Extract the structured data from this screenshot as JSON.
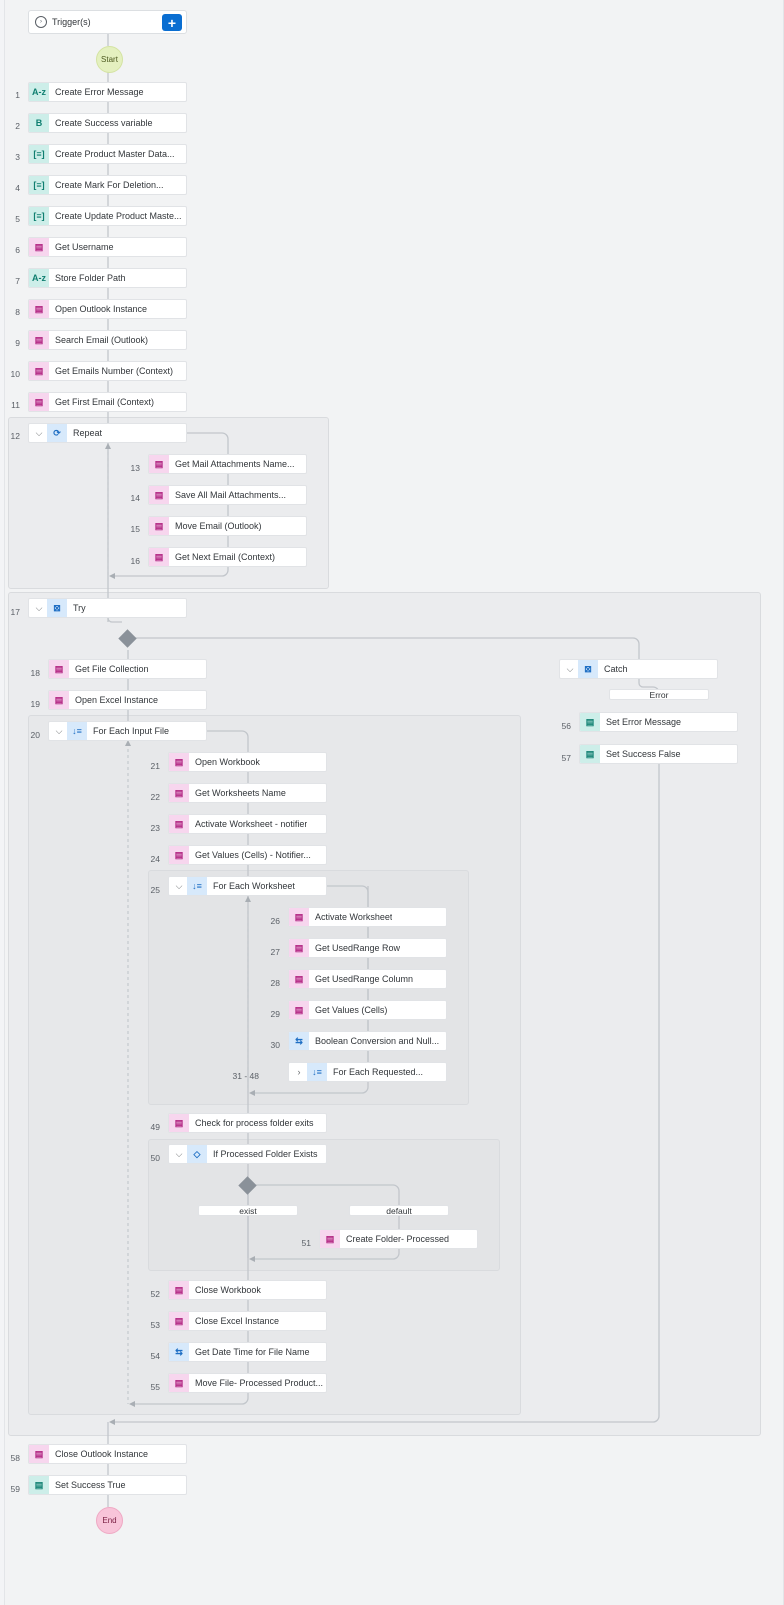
{
  "trigger": {
    "label": "Trigger(s)",
    "add_label": "+"
  },
  "start_label": "Start",
  "end_label": "End",
  "steps": [
    {
      "num": "1",
      "label": "Create Error Message",
      "icon": "A-z",
      "color": "teal",
      "icon_name": "text-variable-icon"
    },
    {
      "num": "2",
      "label": "Create Success variable",
      "icon": "B",
      "color": "teal",
      "icon_name": "boolean-variable-icon"
    },
    {
      "num": "3",
      "label": "Create Product Master Data...",
      "icon": "[≡]",
      "color": "teal",
      "icon_name": "list-variable-icon"
    },
    {
      "num": "4",
      "label": "Create Mark For Deletion...",
      "icon": "[≡]",
      "color": "teal",
      "icon_name": "list-variable-icon"
    },
    {
      "num": "5",
      "label": "Create Update Product Maste...",
      "icon": "[≡]",
      "color": "teal",
      "icon_name": "list-variable-icon"
    },
    {
      "num": "6",
      "label": "Get Username",
      "icon": "▤",
      "color": "pink",
      "icon_name": "activity-icon"
    },
    {
      "num": "7",
      "label": "Store Folder Path",
      "icon": "A-z",
      "color": "teal",
      "icon_name": "text-variable-icon"
    },
    {
      "num": "8",
      "label": "Open Outlook Instance",
      "icon": "▤",
      "color": "pink",
      "icon_name": "activity-icon"
    },
    {
      "num": "9",
      "label": "Search Email (Outlook)",
      "icon": "▤",
      "color": "pink",
      "icon_name": "activity-icon"
    },
    {
      "num": "10",
      "label": "Get Emails Number (Context)",
      "icon": "▤",
      "color": "pink",
      "icon_name": "activity-icon"
    },
    {
      "num": "11",
      "label": "Get First Email (Context)",
      "icon": "▤",
      "color": "pink",
      "icon_name": "activity-icon"
    },
    {
      "num": "12",
      "label": "Repeat",
      "icon": "⟳",
      "color": "blue",
      "icon_name": "repeat-icon",
      "chevron": "⌵"
    },
    {
      "num": "13",
      "label": "Get Mail Attachments Name...",
      "icon": "▤",
      "color": "pink",
      "icon_name": "activity-icon"
    },
    {
      "num": "14",
      "label": "Save All Mail Attachments...",
      "icon": "▤",
      "color": "pink",
      "icon_name": "activity-icon"
    },
    {
      "num": "15",
      "label": "Move Email (Outlook)",
      "icon": "▤",
      "color": "pink",
      "icon_name": "activity-icon"
    },
    {
      "num": "16",
      "label": "Get Next Email (Context)",
      "icon": "▤",
      "color": "pink",
      "icon_name": "activity-icon"
    },
    {
      "num": "17",
      "label": "Try",
      "icon": "⊠",
      "color": "blue",
      "icon_name": "try-icon",
      "chevron": "⌵"
    },
    {
      "num": "18",
      "label": "Get File Collection",
      "icon": "▤",
      "color": "pink",
      "icon_name": "activity-icon"
    },
    {
      "num": "19",
      "label": "Open Excel Instance",
      "icon": "▤",
      "color": "pink",
      "icon_name": "activity-icon"
    },
    {
      "num": "20",
      "label": "For Each Input File",
      "icon": "↓≡",
      "color": "blue",
      "icon_name": "for-each-icon",
      "chevron": "⌵"
    },
    {
      "num": "21",
      "label": "Open Workbook",
      "icon": "▤",
      "color": "pink",
      "icon_name": "activity-icon"
    },
    {
      "num": "22",
      "label": "Get Worksheets Name",
      "icon": "▤",
      "color": "pink",
      "icon_name": "activity-icon"
    },
    {
      "num": "23",
      "label": "Activate Worksheet - notifier",
      "icon": "▤",
      "color": "pink",
      "icon_name": "activity-icon"
    },
    {
      "num": "24",
      "label": "Get Values (Cells) - Notifier...",
      "icon": "▤",
      "color": "pink",
      "icon_name": "activity-icon"
    },
    {
      "num": "25",
      "label": "For Each Worksheet",
      "icon": "↓≡",
      "color": "blue",
      "icon_name": "for-each-icon",
      "chevron": "⌵"
    },
    {
      "num": "26",
      "label": "Activate Worksheet",
      "icon": "▤",
      "color": "pink",
      "icon_name": "activity-icon"
    },
    {
      "num": "27",
      "label": "Get UsedRange Row",
      "icon": "▤",
      "color": "pink",
      "icon_name": "activity-icon"
    },
    {
      "num": "28",
      "label": "Get UsedRange Column",
      "icon": "▤",
      "color": "pink",
      "icon_name": "activity-icon"
    },
    {
      "num": "29",
      "label": "Get Values (Cells)",
      "icon": "▤",
      "color": "pink",
      "icon_name": "activity-icon"
    },
    {
      "num": "30",
      "label": "Boolean Conversion and Null...",
      "icon": "⇆",
      "color": "blue",
      "icon_name": "script-icon"
    },
    {
      "num": "31 - 48",
      "label": "For Each Requested...",
      "icon": "↓≡",
      "color": "blue",
      "icon_name": "for-each-icon",
      "chevron": "›"
    },
    {
      "num": "49",
      "label": "Check for process folder exits",
      "icon": "▤",
      "color": "pink",
      "icon_name": "activity-icon"
    },
    {
      "num": "50",
      "label": "If Processed Folder Exists",
      "icon": "◇",
      "color": "blue",
      "icon_name": "condition-icon",
      "chevron": "⌵"
    },
    {
      "num": "51",
      "label": "Create Folder- Processed",
      "icon": "▤",
      "color": "pink",
      "icon_name": "activity-icon"
    },
    {
      "num": "52",
      "label": "Close Workbook",
      "icon": "▤",
      "color": "pink",
      "icon_name": "activity-icon"
    },
    {
      "num": "53",
      "label": "Close Excel Instance",
      "icon": "▤",
      "color": "pink",
      "icon_name": "activity-icon"
    },
    {
      "num": "54",
      "label": "Get Date Time for File Name",
      "icon": "⇆",
      "color": "blue",
      "icon_name": "script-icon"
    },
    {
      "num": "55",
      "label": "Move File- Processed Product...",
      "icon": "▤",
      "color": "pink",
      "icon_name": "activity-icon"
    },
    {
      "num": "",
      "label": "Catch",
      "icon": "⊠",
      "color": "blue",
      "icon_name": "catch-icon",
      "chevron": "⌵"
    },
    {
      "num": "56",
      "label": "Set Error Message",
      "icon": "▤",
      "color": "teal",
      "icon_name": "set-variable-icon"
    },
    {
      "num": "57",
      "label": "Set Success False",
      "icon": "▤",
      "color": "teal",
      "icon_name": "set-variable-icon"
    },
    {
      "num": "58",
      "label": "Close Outlook Instance",
      "icon": "▤",
      "color": "pink",
      "icon_name": "activity-icon"
    },
    {
      "num": "59",
      "label": "Set Success True",
      "icon": "▤",
      "color": "teal",
      "icon_name": "set-variable-icon"
    }
  ],
  "branch_labels": {
    "error": "Error",
    "exist": "exist",
    "default": "default"
  }
}
